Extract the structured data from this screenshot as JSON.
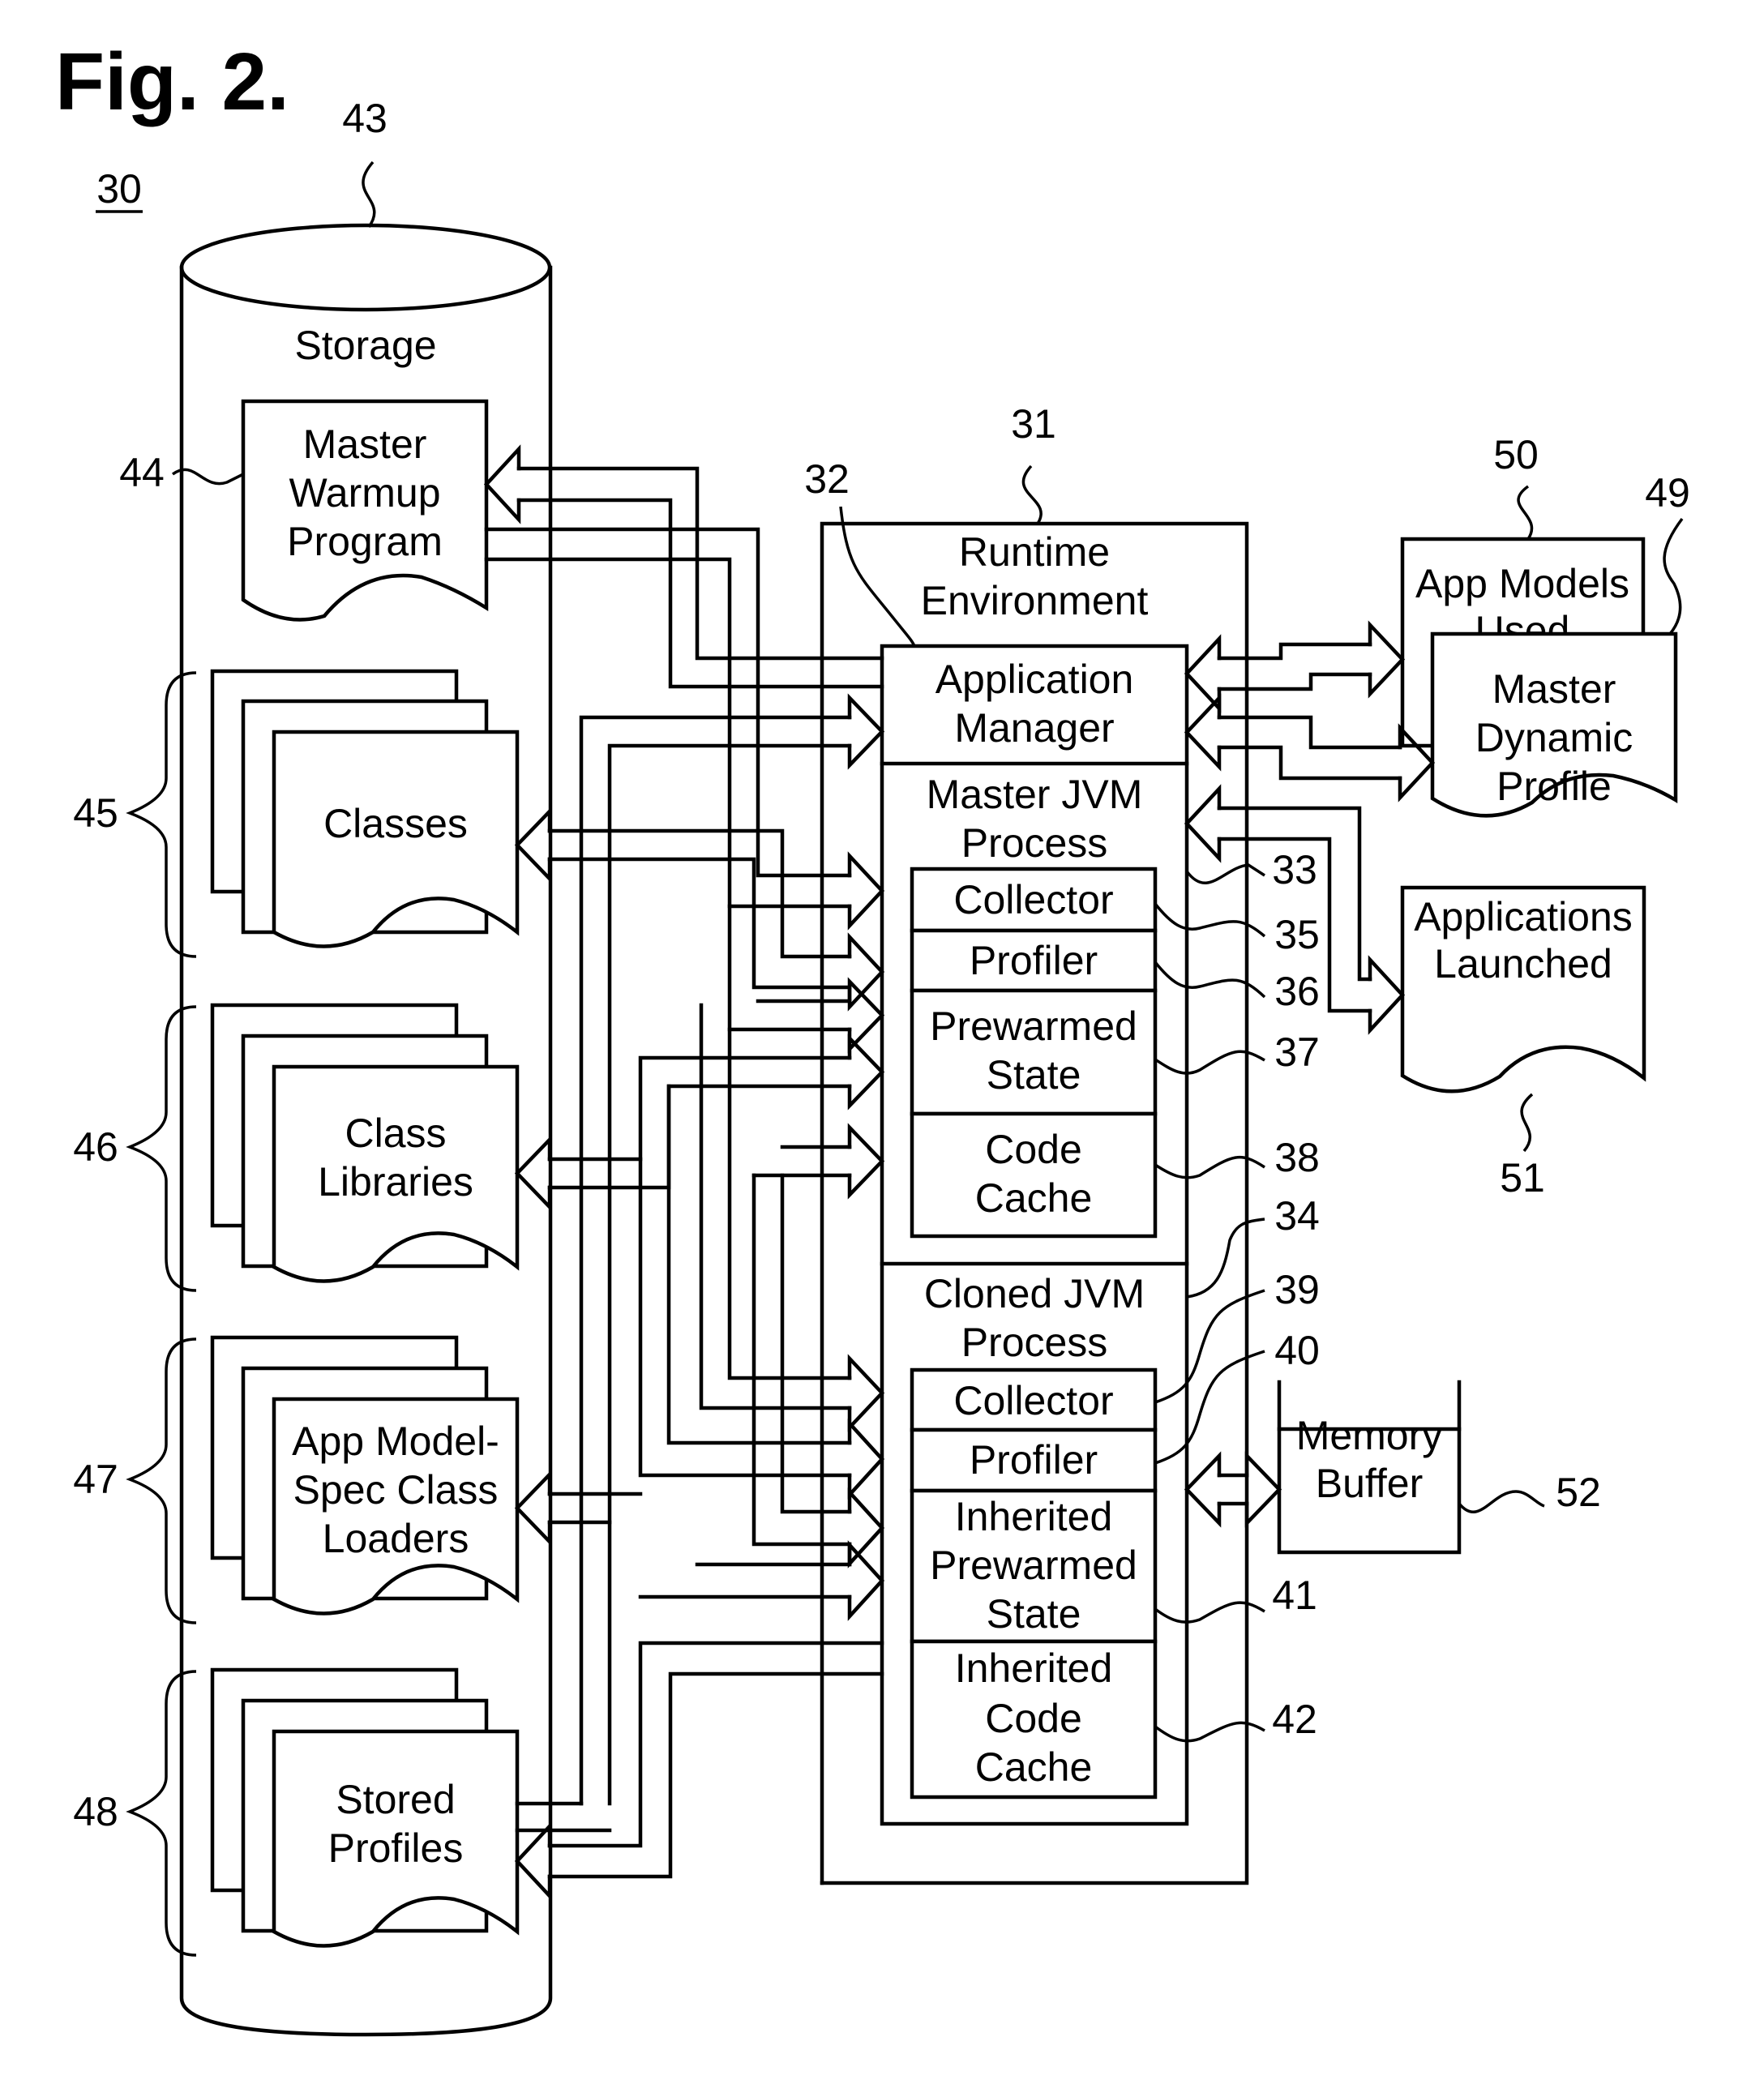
{
  "figure": {
    "title": "Fig. 2.",
    "system_ref": "30"
  },
  "storage": {
    "ref": "43",
    "label": "Storage",
    "items": [
      {
        "ref": "44",
        "lines": [
          "Master",
          "Warmup",
          "Program"
        ]
      },
      {
        "ref": "45",
        "lines": [
          "Classes"
        ]
      },
      {
        "ref": "46",
        "lines": [
          "Class",
          "Libraries"
        ]
      },
      {
        "ref": "47",
        "lines": [
          "App Model-",
          "Spec Class",
          "Loaders"
        ]
      },
      {
        "ref": "48",
        "lines": [
          "Stored",
          "Profiles"
        ]
      }
    ]
  },
  "runtime": {
    "ref": "31",
    "lines": [
      "Runtime",
      "Environment"
    ],
    "app_manager": {
      "ref": "32",
      "lines": [
        "Application",
        "Manager"
      ]
    },
    "master_jvm": {
      "ref": "33",
      "lines": [
        "Master JVM",
        "Process"
      ],
      "components": [
        {
          "ref": "35",
          "lines": [
            "Collector"
          ]
        },
        {
          "ref": "36",
          "lines": [
            "Profiler"
          ]
        },
        {
          "ref": "37",
          "lines": [
            "Prewarmed",
            "State"
          ]
        },
        {
          "ref": "38",
          "lines": [
            "Code",
            "Cache"
          ]
        }
      ]
    },
    "cloned_jvm": {
      "ref": "34",
      "lines": [
        "Cloned JVM",
        "Process"
      ],
      "components": [
        {
          "ref": "39",
          "lines": [
            "Collector"
          ]
        },
        {
          "ref": "40",
          "lines": [
            "Profiler"
          ]
        },
        {
          "ref": "41",
          "lines": [
            "Inherited",
            "Prewarmed",
            "State"
          ]
        },
        {
          "ref": "42",
          "lines": [
            "Inherited",
            "Code",
            "Cache"
          ]
        }
      ]
    }
  },
  "outputs": {
    "app_models_used": {
      "ref": "50",
      "lines": [
        "App Models",
        "Used"
      ]
    },
    "master_dynamic_profile": {
      "ref": "49",
      "lines": [
        "Master",
        "Dynamic",
        "Profile"
      ]
    },
    "applications_launched": {
      "ref": "51",
      "lines": [
        "Applications",
        "Launched"
      ]
    },
    "memory_buffer": {
      "ref": "52",
      "lines": [
        "Memory",
        "Buffer"
      ]
    }
  }
}
